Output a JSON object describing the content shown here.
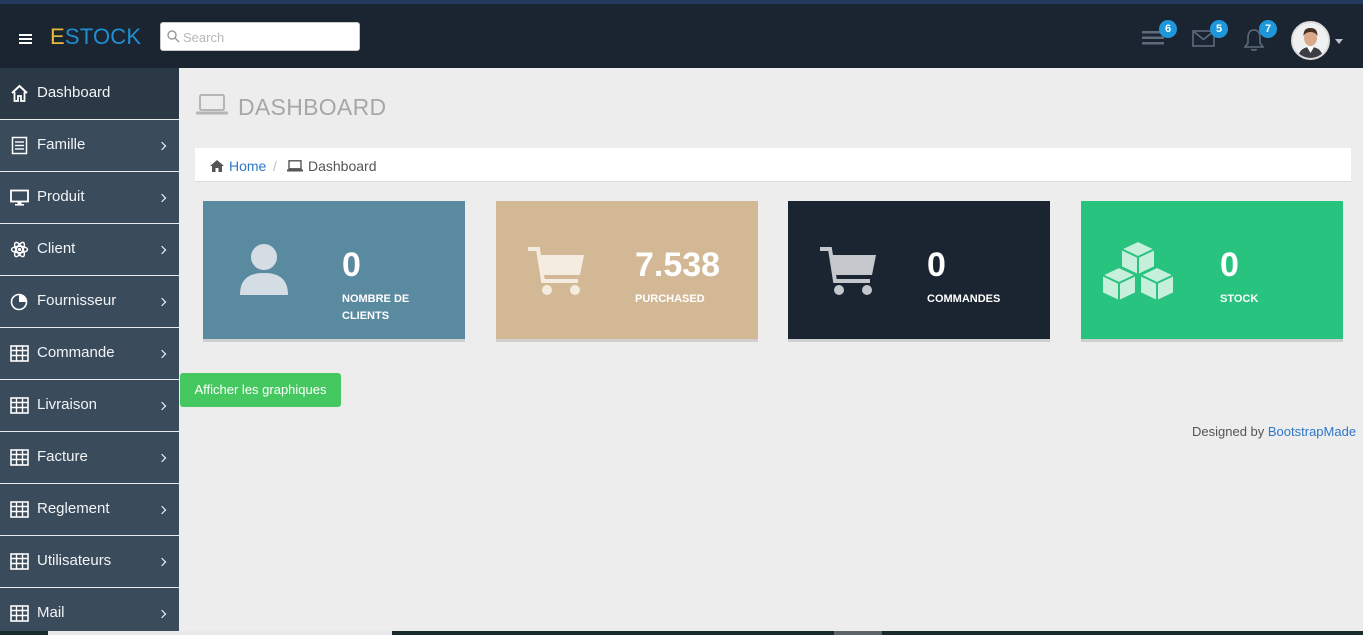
{
  "header": {
    "logo_first": "E",
    "logo_rest": "STOCK",
    "search_placeholder": "Search",
    "badges": {
      "tasks": "6",
      "messages": "5",
      "notifications": "7"
    }
  },
  "sidebar": {
    "items": [
      {
        "label": "Dashboard",
        "icon": "home-icon",
        "active": true
      },
      {
        "label": "Famille",
        "icon": "list-icon"
      },
      {
        "label": "Produit",
        "icon": "desktop-icon"
      },
      {
        "label": "Client",
        "icon": "atom-icon"
      },
      {
        "label": "Fournisseur",
        "icon": "pie-chart-icon"
      },
      {
        "label": "Commande",
        "icon": "table-icon"
      },
      {
        "label": "Livraison",
        "icon": "table-icon"
      },
      {
        "label": "Facture",
        "icon": "table-icon"
      },
      {
        "label": "Reglement",
        "icon": "table-icon"
      },
      {
        "label": "Utilisateurs",
        "icon": "table-icon"
      },
      {
        "label": "Mail",
        "icon": "table-icon"
      }
    ]
  },
  "page": {
    "title": "DASHBOARD",
    "breadcrumb_home": "Home",
    "breadcrumb_sep": "/",
    "breadcrumb_current": "Dashboard"
  },
  "tiles": [
    {
      "value": "0",
      "caption": "NOMBRE DE CLIENTS",
      "color": "#5a8aa0",
      "icon": "user-icon"
    },
    {
      "value": "7.538",
      "caption": "PURCHASED",
      "color": "#d2b894",
      "icon": "cart-icon"
    },
    {
      "value": "0",
      "caption": "COMMANDES",
      "color": "#1b2532",
      "icon": "cart-icon"
    },
    {
      "value": "0",
      "caption": "STOCK",
      "color": "#29c380",
      "icon": "cubes-icon"
    }
  ],
  "actions": {
    "show_charts": "Afficher les graphiques"
  },
  "footer": {
    "text": "Designed by ",
    "link": "BootstrapMade"
  },
  "colors": {
    "header_bg": "#1b2532",
    "sidebar_bg": "#3a4b5c",
    "accent_blue": "#1f8fd0",
    "logo_e": "#e8b93a",
    "badge": "#1d97d9",
    "button_green": "#46c860"
  }
}
